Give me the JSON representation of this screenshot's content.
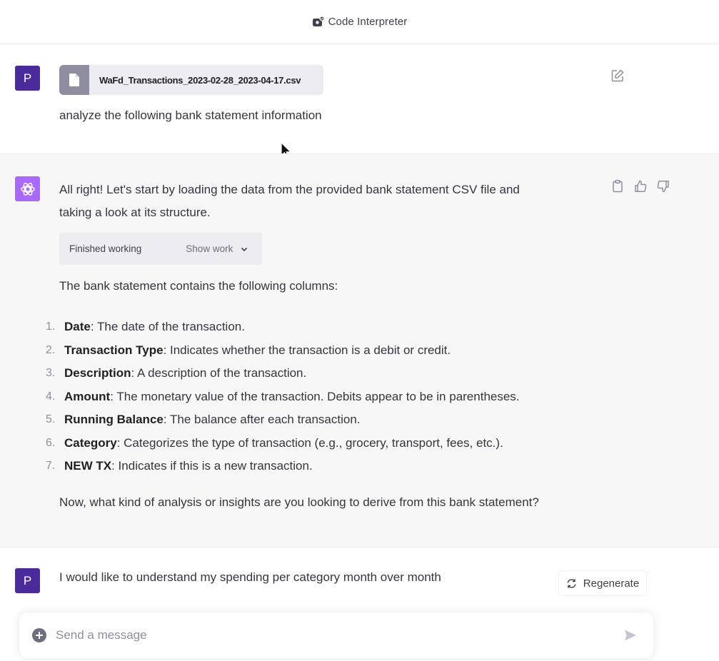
{
  "header": {
    "title": "Code Interpreter",
    "icon": "code-interpreter-icon"
  },
  "messages": {
    "user1": {
      "avatar_letter": "P",
      "file_name": "WaFd_Transactions_2023-02-28_2023-04-17.csv",
      "text": "analyze the following bank statement information"
    },
    "assistant": {
      "intro_line1": "All right! Let's start by loading the data from the provided bank statement CSV file and",
      "intro_line2": "taking a look at its structure.",
      "working_status": "Finished working",
      "show_work_label": "Show work",
      "columns_intro": "The bank statement contains the following columns:",
      "columns": [
        {
          "num": "1.",
          "name": "Date",
          "desc": ": The date of the transaction."
        },
        {
          "num": "2.",
          "name": "Transaction Type",
          "desc": ": Indicates whether the transaction is a debit or credit."
        },
        {
          "num": "3.",
          "name": "Description",
          "desc": ": A description of the transaction."
        },
        {
          "num": "4.",
          "name": "Amount",
          "desc": ": The monetary value of the transaction. Debits appear to be in parentheses."
        },
        {
          "num": "5.",
          "name": "Running Balance",
          "desc": ": The balance after each transaction."
        },
        {
          "num": "6.",
          "name": "Category",
          "desc": ": Categorizes the type of transaction (e.g., grocery, transport, fees, etc.)."
        },
        {
          "num": "7.",
          "name": "NEW TX",
          "desc": ": Indicates if this is a new transaction."
        }
      ],
      "closing_question": "Now, what kind of analysis or insights are you looking to derive from this bank statement?"
    },
    "user2": {
      "avatar_letter": "P",
      "text": "I would like to understand my spending per category month over month"
    }
  },
  "regenerate_label": "Regenerate",
  "composer": {
    "placeholder": "Send a message"
  },
  "colors": {
    "user_avatar": "#4b2a9b",
    "assistant_avatar": "#ab68ff",
    "assistant_bg": "#f7f7f8"
  }
}
